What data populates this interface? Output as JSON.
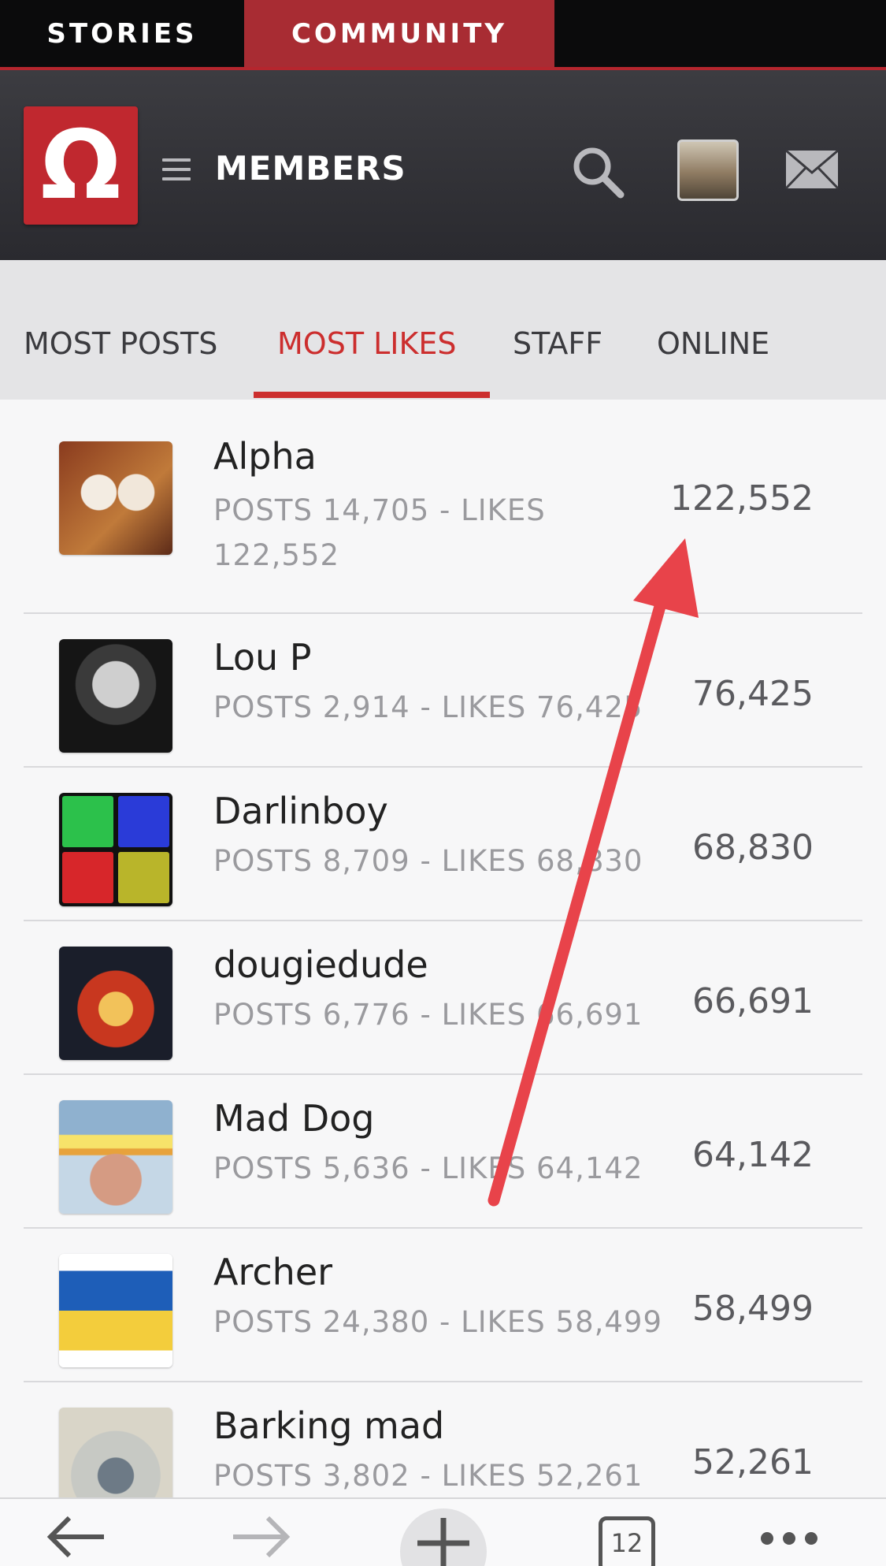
{
  "top_nav": {
    "stories": "STORIES",
    "community": "COMMUNITY"
  },
  "header": {
    "logo_glyph": "Ω",
    "title": "MEMBERS"
  },
  "tabs": [
    {
      "label": "MOST POSTS"
    },
    {
      "label": "MOST LIKES",
      "active": true
    },
    {
      "label": "STAFF"
    },
    {
      "label": "ONLINE"
    }
  ],
  "members": [
    {
      "name": "Alpha",
      "stats": "POSTS 14,705 - LIKES 122,552",
      "likes": "122,552"
    },
    {
      "name": "Lou P",
      "stats": "POSTS 2,914 - LIKES 76,425",
      "likes": "76,425"
    },
    {
      "name": "Darlinboy",
      "stats": "POSTS 8,709 - LIKES 68,830",
      "likes": "68,830"
    },
    {
      "name": "dougiedude",
      "stats": "POSTS 6,776 - LIKES 66,691",
      "likes": "66,691"
    },
    {
      "name": "Mad Dog",
      "stats": "POSTS 5,636 - LIKES 64,142",
      "likes": "64,142"
    },
    {
      "name": "Archer",
      "stats": "POSTS 24,380 - LIKES 58,499",
      "likes": "58,499"
    },
    {
      "name": "Barking mad",
      "stats": "POSTS 3,802 - LIKES 52,261",
      "likes": "52,261"
    }
  ],
  "bottom_bar": {
    "tabs_count": "12"
  },
  "colors": {
    "accent": "#cc2e2e",
    "brand": "#c0282f",
    "header_bg": "#333338",
    "annotation_arrow": "#e8434a"
  },
  "icons": [
    "menu-icon",
    "search-icon",
    "mail-icon",
    "back-arrow-icon",
    "forward-arrow-icon",
    "plus-icon",
    "tabs-icon",
    "more-icon"
  ]
}
